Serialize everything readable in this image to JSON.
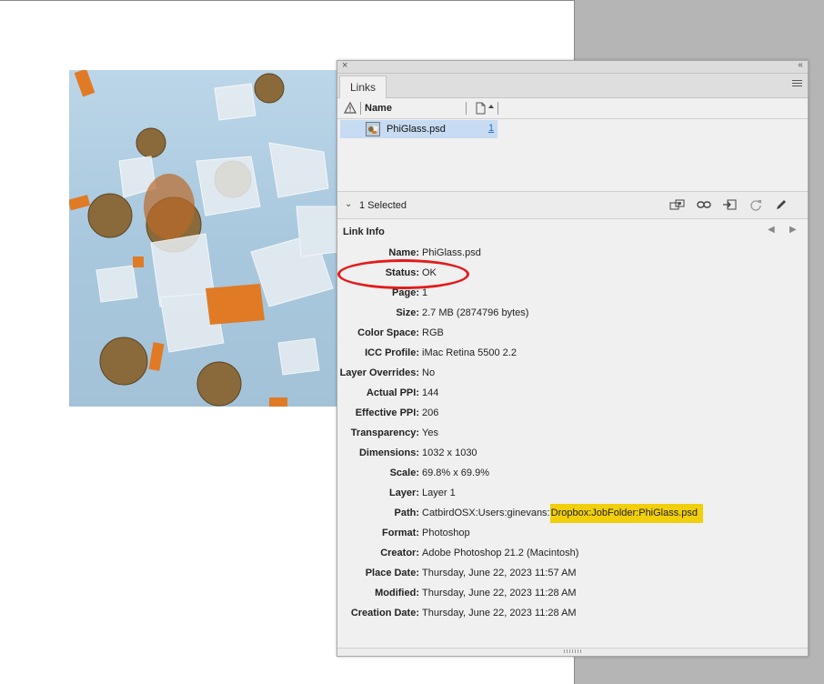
{
  "panel": {
    "close_glyph": "×",
    "collapse_glyph": "‹‹",
    "tab_label": "Links",
    "menu_icon": "hamburger-menu-icon"
  },
  "columns": {
    "warning_icon": "warning-triangle-icon",
    "name_label": "Name",
    "page_icon": "page-icon",
    "sort_glyph": "▴"
  },
  "link": {
    "name": "PhiGlass.psd",
    "page": "1"
  },
  "selection": {
    "chevron": "⌄",
    "count_label": "1 Selected",
    "tools": [
      "relink-from-cc-icon",
      "relink-icon",
      "goto-link-icon",
      "update-link-icon",
      "edit-original-icon"
    ]
  },
  "link_info": {
    "title": "Link Info",
    "prev_glyph": "◀",
    "next_glyph": "▶",
    "rows": [
      {
        "label": "Name:",
        "value": "PhiGlass.psd"
      },
      {
        "label": "Status:",
        "value": "OK"
      },
      {
        "label": "Page:",
        "value": "1"
      },
      {
        "label": "Size:",
        "value": "2.7 MB (2874796 bytes)"
      },
      {
        "label": "Color Space:",
        "value": "RGB"
      },
      {
        "label": "ICC Profile:",
        "value": "iMac Retina 5500 2.2"
      },
      {
        "label": "Layer Overrides:",
        "value": "No"
      },
      {
        "label": "Actual PPI:",
        "value": "144"
      },
      {
        "label": "Effective PPI:",
        "value": "206"
      },
      {
        "label": "Transparency:",
        "value": "Yes"
      },
      {
        "label": "Dimensions:",
        "value": "1032 x 1030"
      },
      {
        "label": "Scale:",
        "value": "69.8% x 69.9%"
      },
      {
        "label": "Layer:",
        "value": "Layer 1"
      },
      {
        "label": "Path:",
        "value_prefix": "CatbirdOSX:Users:ginevans:",
        "value_highlight": "Dropbox:JobFolder:PhiGlass.psd"
      },
      {
        "label": "Format:",
        "value": "Photoshop"
      },
      {
        "label": "Creator:",
        "value": "Adobe Photoshop 21.2 (Macintosh)"
      },
      {
        "label": "Place Date:",
        "value": "Thursday, June 22, 2023 11:57 AM"
      },
      {
        "label": "Modified:",
        "value": "Thursday, June 22, 2023 11:28 AM"
      },
      {
        "label": "Creation Date:",
        "value": "Thursday, June 22, 2023 11:28 AM"
      }
    ]
  },
  "colors": {
    "selection_row": "#c7dbf2",
    "status_annotation": "#e31b1b",
    "path_highlight": "#f1cf0b",
    "image_sky": "#a9c8de"
  }
}
